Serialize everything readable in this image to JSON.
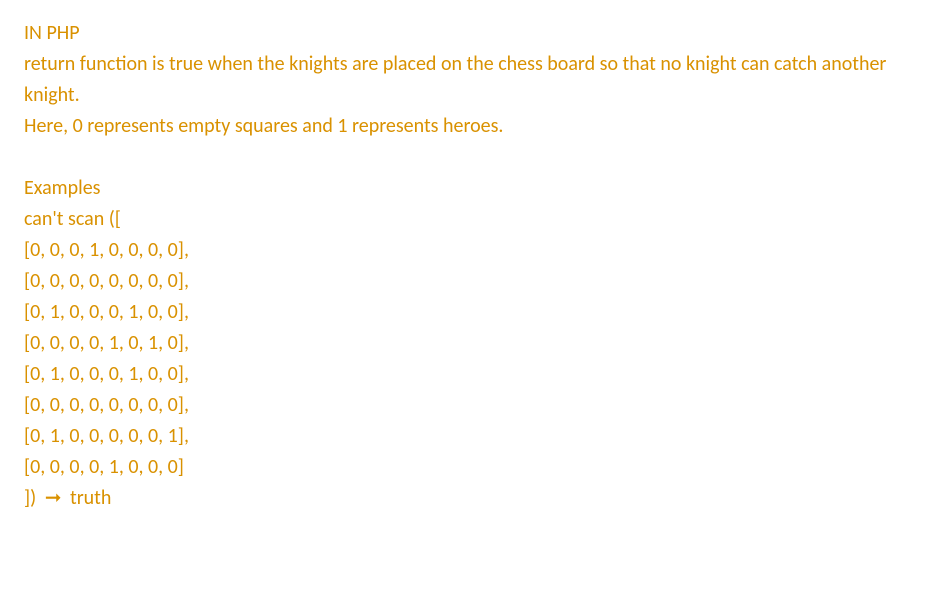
{
  "line1": "IN PHP",
  "line2": "return function is true when the knights are placed on the chess board so that no knight can catch another knight.",
  "line3": " Here, 0 represents empty squares and 1 represents heroes.",
  "examples_heading": "Examples",
  "call_open": "can't scan ([",
  "rows": [
    "  [0, 0, 0, 1, 0, 0, 0, 0],",
    "  [0, 0, 0, 0, 0, 0, 0, 0],",
    "  [0, 1, 0, 0, 0, 1, 0, 0],",
    "  [0, 0, 0, 0, 1, 0, 1, 0],",
    "  [0, 1, 0, 0, 0, 1, 0, 0],",
    "  [0, 0, 0, 0, 0, 0, 0, 0],",
    "  [0, 1, 0, 0, 0, 0, 0, 1],",
    "  [0, 0, 0, 0, 1, 0, 0, 0]"
  ],
  "call_close_prefix": "]) ",
  "arrow": "➞",
  "result": " truth"
}
